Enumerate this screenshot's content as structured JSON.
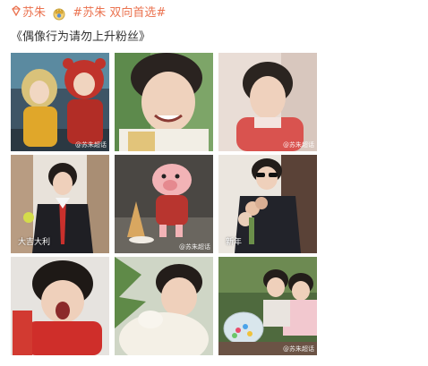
{
  "post": {
    "super_topic": "苏朱",
    "hashtag": "#苏朱 双向首选#",
    "title": "《偶像行为请勿上升粉丝》"
  },
  "photos": [
    {
      "name": "photo-1",
      "caption": "",
      "watermark": "@苏朱超话"
    },
    {
      "name": "photo-2",
      "caption": "",
      "watermark": ""
    },
    {
      "name": "photo-3",
      "caption": "",
      "watermark": "@苏朱超话"
    },
    {
      "name": "photo-4",
      "caption": "大吉大利",
      "watermark": ""
    },
    {
      "name": "photo-5",
      "caption": "",
      "watermark": "@苏朱超话"
    },
    {
      "name": "photo-6",
      "caption": "新年",
      "watermark": ""
    },
    {
      "name": "photo-7",
      "caption": "",
      "watermark": ""
    },
    {
      "name": "photo-8",
      "caption": "",
      "watermark": ""
    },
    {
      "name": "photo-9",
      "caption": "",
      "watermark": "@苏朱超话"
    }
  ],
  "colors": {
    "link": "#eb7350",
    "text": "#333333"
  }
}
